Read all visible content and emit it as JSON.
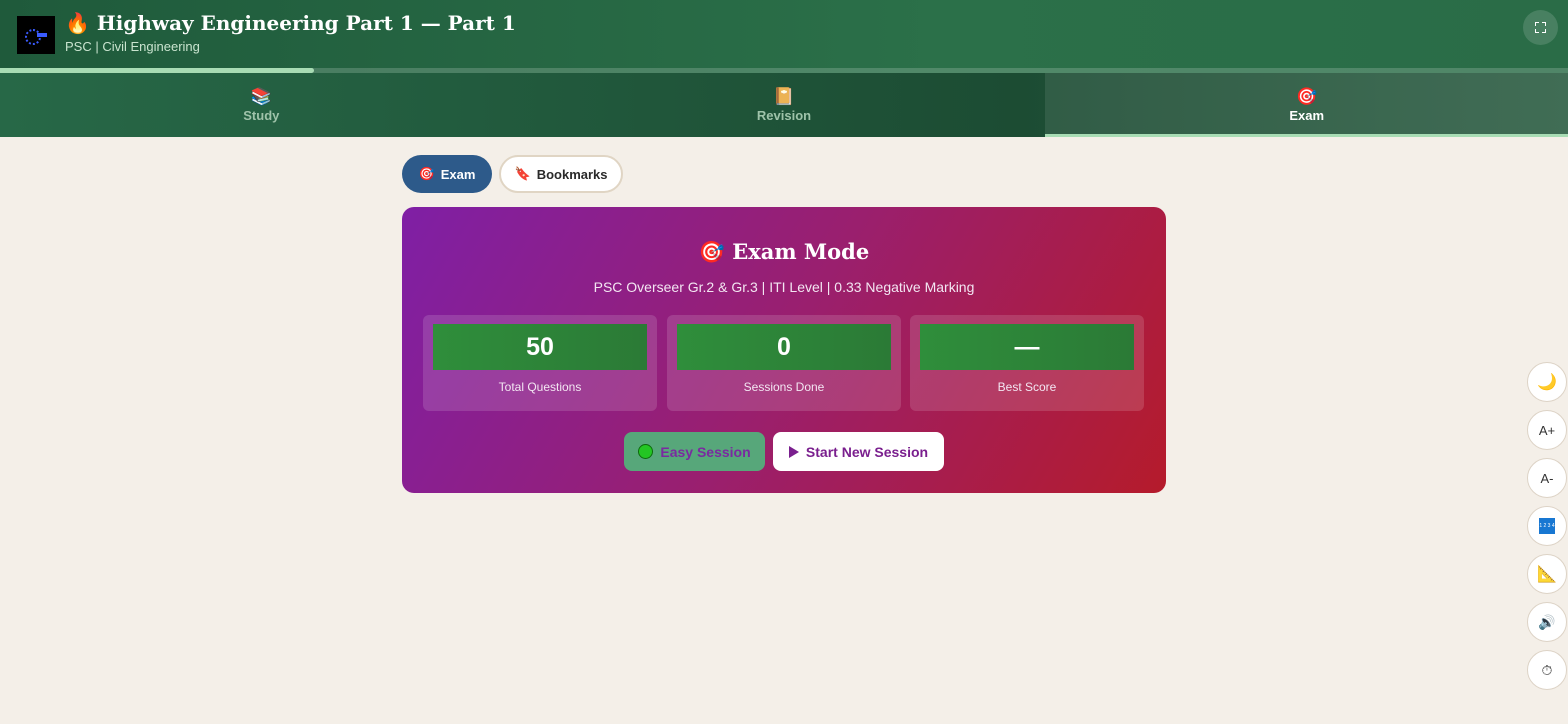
{
  "header": {
    "title": "🔥 Highway Engineering Part 1 — Part 1",
    "subtitle": "PSC | Civil Engineering",
    "fullscreen_icon": "fullscreen-icon",
    "progress_fraction": 0.2
  },
  "tabs": [
    {
      "label": "Study",
      "icon": "📚",
      "active": false
    },
    {
      "label": "Revision",
      "icon": "📔",
      "active": false
    },
    {
      "label": "Exam",
      "icon": "🎯",
      "active": true
    }
  ],
  "subtabs": [
    {
      "label": "Exam",
      "icon": "🎯",
      "active": true
    },
    {
      "label": "Bookmarks",
      "icon": "🔖",
      "active": false
    }
  ],
  "exam_card": {
    "title": "🎯 Exam Mode",
    "description": "PSC Overseer Gr.2 & Gr.3 | ITI Level | 0.33 Negative Marking",
    "stats": [
      {
        "value": "50",
        "label": "Total Questions"
      },
      {
        "value": "0",
        "label": "Sessions Done"
      },
      {
        "value": "—",
        "label": "Best Score"
      }
    ],
    "easy_button": "Easy Session",
    "start_button": "Start New Session"
  },
  "tools": {
    "dark_mode": "🌙",
    "font_increase": "A+",
    "font_decrease": "A-",
    "calculator": "1 2 3 4",
    "ruler": "📐",
    "sound": "🔊",
    "timer": "⏱"
  },
  "colors": {
    "header_green": "#2b7049",
    "tabs_green": "#1c4c33",
    "accent_blue": "#2d5a8a",
    "card_purple": "#7f1fa5",
    "card_red": "#b51b2b",
    "stat_green": "#2f8e3b",
    "background": "#f4efe8"
  }
}
